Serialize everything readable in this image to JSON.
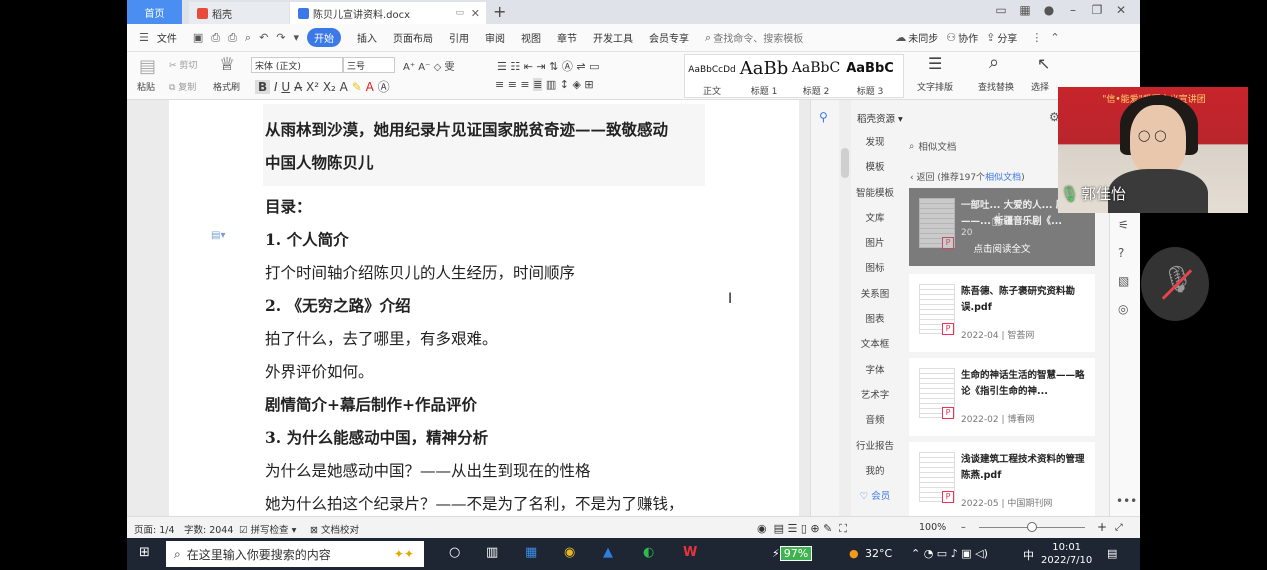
{
  "tabs": {
    "home": "首页",
    "daoke": "稻壳",
    "doc": "陈贝儿宣讲资料.docx",
    "new_tab": "+"
  },
  "menu": {
    "file": "文件",
    "start": "开始",
    "insert": "插入",
    "layout": "页面布局",
    "reference": "引用",
    "review": "审阅",
    "view": "视图",
    "chapter": "章节",
    "devtools": "开发工具",
    "vip": "会员专享",
    "search_placeholder": "查找命令、搜索模板",
    "sync": "未同步",
    "collab": "协作",
    "share": "分享"
  },
  "ribbon": {
    "paste": "粘贴",
    "cut": "剪切",
    "copy": "复制",
    "format_painter": "格式刷",
    "font_name": "宋体 (正文)",
    "font_size": "三号",
    "styles": [
      {
        "preview": "AaBbCcDd",
        "label": "正文"
      },
      {
        "preview": "AaBb",
        "label": "标题 1"
      },
      {
        "preview": "AaBbC",
        "label": "标题 2"
      },
      {
        "preview": "AaBbC",
        "label": "标题 3"
      }
    ],
    "text_layout": "文字排版",
    "find_replace": "查找替换",
    "select": "选择"
  },
  "document": {
    "title_line1": "从雨林到沙漠，她用纪录片见证国家脱贫奇迹——致敬感动",
    "title_line2": "中国人物陈贝儿",
    "lines": [
      {
        "text": "目录：",
        "bold": true
      },
      {
        "text": "1. 个人简介",
        "bold": true
      },
      {
        "text": "打个时间轴介绍陈贝儿的人生经历，时间顺序",
        "bold": false
      },
      {
        "text": "2. 《无穷之路》介绍",
        "bold": true
      },
      {
        "text": "拍了什么，去了哪里，有多艰难。",
        "bold": false
      },
      {
        "text": "外界评价如何。",
        "bold": false
      },
      {
        "text": "剧情简介+幕后制作+作品评价",
        "bold": true
      },
      {
        "text": "3. 为什么能感动中国，精神分析",
        "bold": true
      },
      {
        "text": "为什么是她感动中国？——从出生到现在的性格",
        "bold": false
      },
      {
        "text": "她为什么拍这个纪录片？——不是为了名利，不是为了赚钱，",
        "bold": false
      }
    ]
  },
  "resource_panel": {
    "header": "稻壳资源",
    "nav": [
      "发现",
      "模板",
      "智能模板",
      "文库",
      "图片",
      "图标",
      "关系图",
      "图表",
      "文本框",
      "字体",
      "艺术字",
      "音频",
      "行业报告",
      "我的",
      "会员"
    ],
    "search_value": "相似文档",
    "back": "返回",
    "recommend_prefix": "(推荐197个",
    "recommend_link": "相似文档",
    "recommend_suffix": ")",
    "cards": [
      {
        "title": "一部吐... 大爱的人... 剧——... 新疆音乐剧《...",
        "meta": "20",
        "overlay": "点击阅读全文"
      },
      {
        "title": "陈吾德、陈子褒研究资料勘误.pdf",
        "meta": "2022-04 | 智荟网"
      },
      {
        "title": "生命的神话生活的智慧——略论《指引生命的神...",
        "meta": "2022-02 | 博看网"
      },
      {
        "title": "浅谈建筑工程技术资料的管理 陈燕.pdf",
        "meta": "2022-05 | 中国期刊网"
      }
    ]
  },
  "status": {
    "page": "页面: 1/4",
    "words": "字数: 2044",
    "spell": "拼写检查",
    "proof": "文档校对",
    "zoom": "100%",
    "zoom_level": 0.5
  },
  "taskbar": {
    "search_placeholder": "在这里输入你要搜索的内容",
    "battery": "97%",
    "temp": "32°C",
    "ime": "中",
    "time": "10:01",
    "date": "2022/7/10"
  },
  "video": {
    "banner": "\"信•能爱\"爱国主义宣讲团",
    "name": "郭佳怡"
  },
  "colors": {
    "accent": "#3b79e6",
    "tab_active": "#4a8ef1",
    "taskbar": "#1e2533",
    "mute_red": "#e4444c"
  }
}
